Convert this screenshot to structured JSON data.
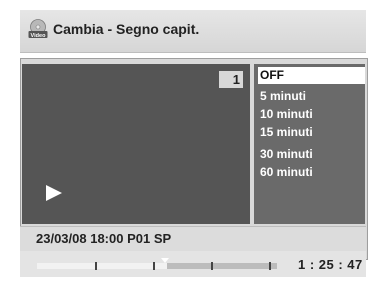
{
  "header": {
    "icon": "video-disc-icon",
    "icon_label": "Video",
    "title": "Cambia - Segno capit."
  },
  "preview": {
    "chapter_number": "1",
    "play_icon": "play-icon"
  },
  "menu": {
    "options": [
      {
        "label": "OFF",
        "selected": true
      },
      {
        "label": "5 minuti",
        "selected": false
      },
      {
        "label": "10 minuti",
        "selected": false
      },
      {
        "label": "15 minuti",
        "selected": false
      },
      {
        "label": "30 minuti",
        "selected": false
      },
      {
        "label": "60 minuti",
        "selected": false
      }
    ]
  },
  "info": {
    "text": "23/03/08  18:00  P01  SP"
  },
  "playback": {
    "time": "1 : 25 : 47",
    "progress_fraction": 0.54
  },
  "colors": {
    "menu_bg": "#6a6a6a",
    "selected_bg": "#ffffff",
    "preview_bg": "#555555"
  }
}
